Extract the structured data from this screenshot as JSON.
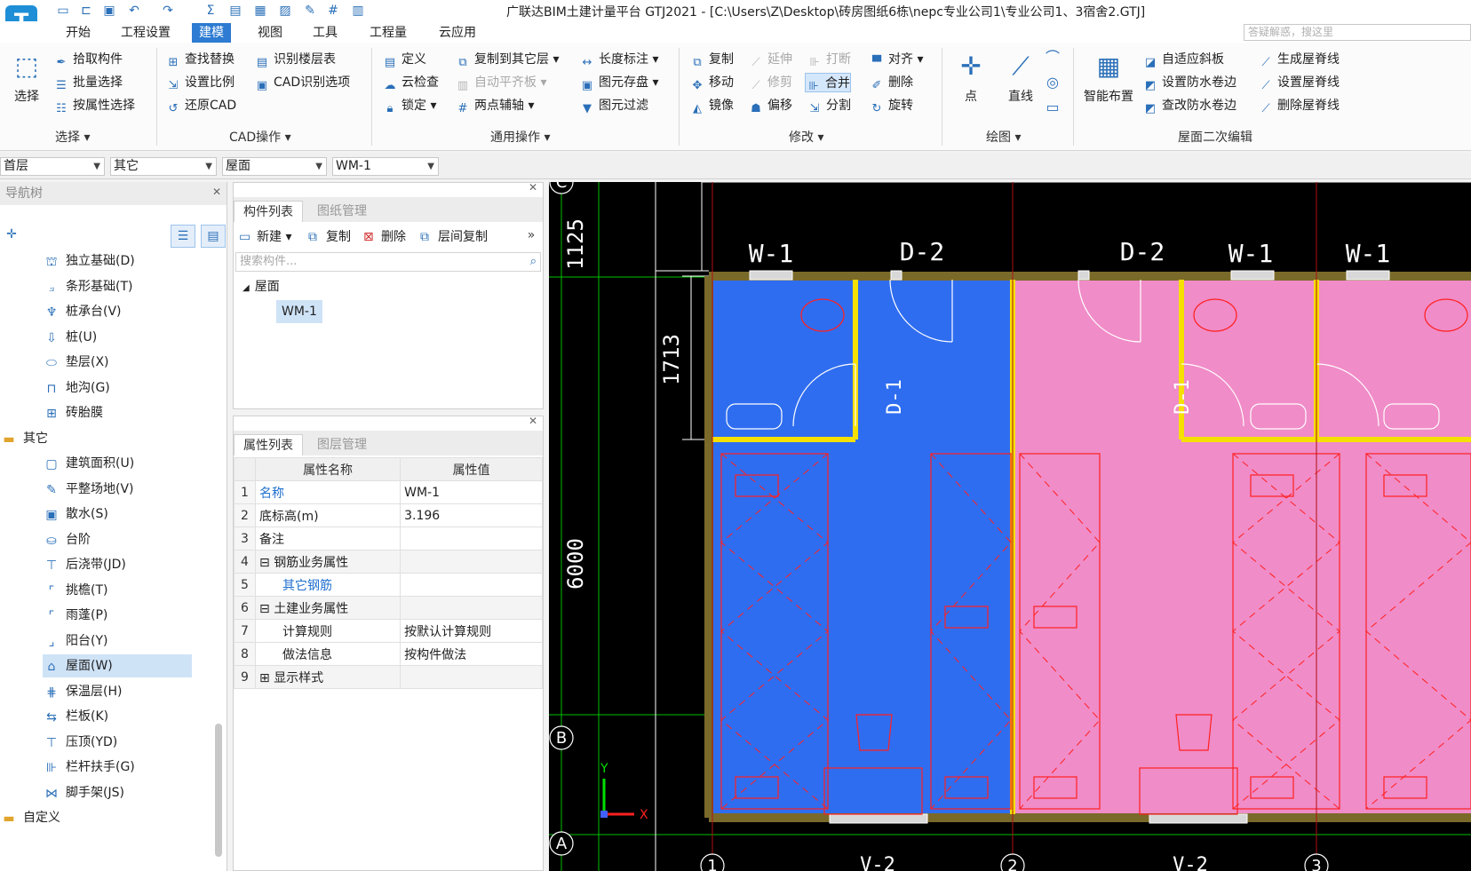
{
  "app": {
    "title": "广联达BIM土建计量平台 GTJ2021 - [C:\\Users\\Z\\Desktop\\砖房图纸6栋\\nepc专业公司1\\专业公司1、3宿舍2.GTJ]",
    "logo_letter": "T"
  },
  "menu": {
    "tabs": [
      "开始",
      "工程设置",
      "建模",
      "视图",
      "工具",
      "工程量",
      "云应用"
    ],
    "active": "建模",
    "search_placeholder": "答疑解惑，搜这里"
  },
  "ribbon": {
    "select_group": {
      "big_button": "选择",
      "items": [
        "拾取构件",
        "批量选择",
        "按属性选择"
      ],
      "label": "选择 ▾"
    },
    "cad_group": {
      "items_col1": [
        "查找替换",
        "设置比例",
        "还原CAD"
      ],
      "items_col2": [
        "识别楼层表",
        "CAD识别选项"
      ],
      "label": "CAD操作 ▾"
    },
    "common_group": {
      "items_col1": [
        "定义",
        "云检查",
        "锁定 ▾"
      ],
      "items_col2": [
        "复制到其它层 ▾",
        "自动平齐板 ▾",
        "两点辅轴 ▾"
      ],
      "items_col3": [
        "长度标注 ▾",
        "图元存盘 ▾",
        "图元过滤"
      ],
      "label": "通用操作 ▾"
    },
    "modify_group": {
      "items_col1": [
        "复制",
        "移动",
        "镜像"
      ],
      "items_col2": [
        "延伸",
        "修剪",
        "偏移"
      ],
      "items_col3": [
        "打断",
        "合并",
        "分割"
      ],
      "items_col4": [
        "对齐 ▾",
        "删除",
        "旋转"
      ],
      "label": "修改 ▾"
    },
    "draw_group": {
      "buttons": [
        "点",
        "直线"
      ],
      "label": "绘图 ▾"
    },
    "roof_group": {
      "big_button": "智能布置",
      "items_col1": [
        "自适应斜板",
        "设置防水卷边",
        "查改防水卷边"
      ],
      "items_col2": [
        "生成屋脊线",
        "设置屋脊线",
        "删除屋脊线"
      ],
      "label": "屋面二次编辑"
    }
  },
  "selectors": {
    "floor": "首层",
    "category": "其它",
    "type": "屋面",
    "component": "WM-1"
  },
  "nav": {
    "header": "导航树",
    "items": [
      {
        "label": "独立基础(D)",
        "icon": "isolated-footing-icon",
        "folder": false
      },
      {
        "label": "条形基础(T)",
        "icon": "strip-footing-icon",
        "folder": false
      },
      {
        "label": "桩承台(V)",
        "icon": "pile-cap-icon",
        "folder": false
      },
      {
        "label": "桩(U)",
        "icon": "pile-icon",
        "folder": false
      },
      {
        "label": "垫层(X)",
        "icon": "cushion-icon",
        "folder": false
      },
      {
        "label": "地沟(G)",
        "icon": "trench-icon",
        "folder": false
      },
      {
        "label": "砖胎膜",
        "icon": "brick-mold-icon",
        "folder": false
      },
      {
        "label": "其它",
        "icon": "folder-icon",
        "folder": true
      },
      {
        "label": "建筑面积(U)",
        "icon": "building-area-icon",
        "folder": false
      },
      {
        "label": "平整场地(V)",
        "icon": "site-leveling-icon",
        "folder": false
      },
      {
        "label": "散水(S)",
        "icon": "apron-icon",
        "folder": false
      },
      {
        "label": "台阶",
        "icon": "step-icon",
        "folder": false
      },
      {
        "label": "后浇带(JD)",
        "icon": "post-cast-strip-icon",
        "folder": false
      },
      {
        "label": "挑檐(T)",
        "icon": "eave-icon",
        "folder": false
      },
      {
        "label": "雨蓬(P)",
        "icon": "canopy-icon",
        "folder": false
      },
      {
        "label": "阳台(Y)",
        "icon": "balcony-icon",
        "folder": false
      },
      {
        "label": "屋面(W)",
        "icon": "roof-icon",
        "folder": false
      },
      {
        "label": "保温层(H)",
        "icon": "insulation-icon",
        "folder": false
      },
      {
        "label": "栏板(K)",
        "icon": "parapet-icon",
        "folder": false
      },
      {
        "label": "压顶(YD)",
        "icon": "coping-icon",
        "folder": false
      },
      {
        "label": "栏杆扶手(G)",
        "icon": "railing-icon",
        "folder": false
      },
      {
        "label": "脚手架(JS)",
        "icon": "scaffold-icon",
        "folder": false
      },
      {
        "label": "自定义",
        "icon": "folder-icon",
        "folder": true
      }
    ],
    "selected": "屋面(W)"
  },
  "components": {
    "tabs": [
      "构件列表",
      "图纸管理"
    ],
    "toolbar": [
      "新建 ▾",
      "复制",
      "删除",
      "层间复制"
    ],
    "search_placeholder": "搜索构件...",
    "tree_root": "屋面",
    "tree_child": "WM-1"
  },
  "properties": {
    "tabs": [
      "属性列表",
      "图层管理"
    ],
    "headers": [
      "属性名称",
      "属性值"
    ],
    "rows": [
      {
        "n": "1",
        "name": "名称",
        "value": "WM-1"
      },
      {
        "n": "2",
        "name": "底标高(m)",
        "value": "3.196"
      },
      {
        "n": "3",
        "name": "备注",
        "value": ""
      },
      {
        "n": "4",
        "name": "钢筋业务属性",
        "value": ""
      },
      {
        "n": "5",
        "name": "其它钢筋",
        "value": ""
      },
      {
        "n": "6",
        "name": "土建业务属性",
        "value": ""
      },
      {
        "n": "7",
        "name": "计算规则",
        "value": "按默认计算规则"
      },
      {
        "n": "8",
        "name": "做法信息",
        "value": "按构件做法"
      },
      {
        "n": "9",
        "name": "显示样式",
        "value": ""
      }
    ]
  },
  "cad": {
    "dims": [
      "1125",
      "1713",
      "6000"
    ],
    "axis_rows": [
      "C",
      "B",
      "A"
    ],
    "axis_cols": [
      "1",
      "2",
      "3"
    ],
    "window_labels": [
      "W-1",
      "D-2",
      "D-2",
      "W-1",
      "W-1"
    ],
    "door_labels": [
      "D-1",
      "D-1"
    ],
    "bottom_labels": [
      "V-2",
      "V-2"
    ],
    "ucs_x": "X",
    "ucs_y": "Y",
    "colors": {
      "blue_roof": "#2f6df0",
      "pink_roof": "#f08cc8",
      "wall": "#f5e000",
      "red_line": "#ff2020"
    }
  }
}
